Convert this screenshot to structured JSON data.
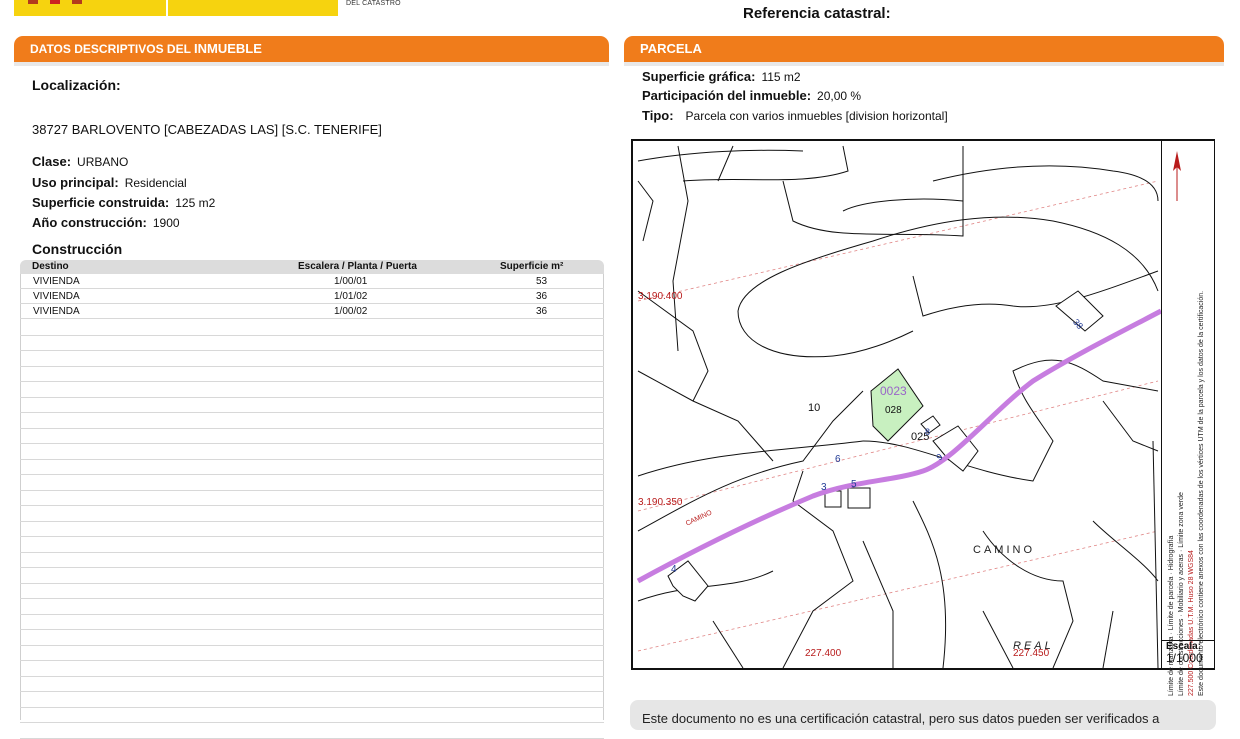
{
  "header": {
    "agency_text": "DEL CATASTRO",
    "reference_label": "Referencia catastral:"
  },
  "left_section": {
    "title_prefix": "DATOS DESCRIPTIVOS DEL ",
    "title_bold": "INMUEBLE",
    "localizacion_label": "Localización:",
    "address": "38727 BARLOVENTO [CABEZADAS LAS] [S.C. TENERIFE]",
    "clase_label": "Clase:",
    "clase_value": "URBANO",
    "uso_label": "Uso principal:",
    "uso_value": "Residencial",
    "superficie_label": "Superficie construida:",
    "superficie_value": "125 m2",
    "anio_label": "Año construcción:",
    "anio_value": "1900",
    "construccion_title": "Construcción",
    "table": {
      "headers": [
        "Destino",
        "Escalera / Planta / Puerta",
        "Superficie m²"
      ],
      "rows": [
        [
          "VIVIENDA",
          "1/00/01",
          "53"
        ],
        [
          "VIVIENDA",
          "1/01/02",
          "36"
        ],
        [
          "VIVIENDA",
          "1/00/02",
          "36"
        ]
      ]
    }
  },
  "right_section": {
    "title": "PARCELA",
    "superficie_label": "Superficie gráfica:",
    "superficie_value": "115 m2",
    "participacion_label": "Participación del inmueble:",
    "participacion_value": "20,00 %",
    "tipo_label": "Tipo:",
    "tipo_value": "Parcela con varios inmuebles [division horizontal]"
  },
  "map": {
    "coord_labels": [
      "3.190.400",
      "3.190.350",
      "227.400",
      "227.450"
    ],
    "parcel_id": "0023",
    "parcel_number": "028",
    "numbers": [
      "10",
      "6",
      "3",
      "5",
      "4",
      "38",
      "025",
      "8",
      "9"
    ],
    "street_labels": [
      "CAMINO",
      "CAMINO",
      "REAL"
    ],
    "legend": {
      "items": [
        "Límite de manzana",
        "Límite de construcciones",
        "Límite de parcela",
        "Mobiliario y aceras",
        "Hidrografía",
        "Límite zona verde"
      ],
      "coords_note": "227.500 Coordenadas U.T.M. Huso 28 WGS84",
      "electronic_note": "Este documento electrónico contiene anexos con las coordenadas de los vértices UTM de la parcela y los datos de la certificación."
    },
    "scale_label": "Escala:",
    "scale_value": "1/1000"
  },
  "footer_note": "Este documento no es una certificación catastral, pero sus datos pueden ser verificados a",
  "colors": {
    "accent": "#f07c1b",
    "road": "#c77de0",
    "parcel": "#c8f0c0"
  }
}
